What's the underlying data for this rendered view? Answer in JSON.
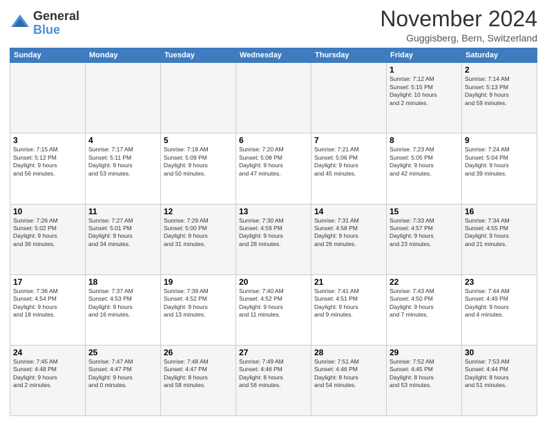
{
  "header": {
    "logo_line1": "General",
    "logo_line2": "Blue",
    "month_title": "November 2024",
    "location": "Guggisberg, Bern, Switzerland"
  },
  "days_of_week": [
    "Sunday",
    "Monday",
    "Tuesday",
    "Wednesday",
    "Thursday",
    "Friday",
    "Saturday"
  ],
  "weeks": [
    [
      {
        "day": "",
        "info": ""
      },
      {
        "day": "",
        "info": ""
      },
      {
        "day": "",
        "info": ""
      },
      {
        "day": "",
        "info": ""
      },
      {
        "day": "",
        "info": ""
      },
      {
        "day": "1",
        "info": "Sunrise: 7:12 AM\nSunset: 5:15 PM\nDaylight: 10 hours\nand 2 minutes."
      },
      {
        "day": "2",
        "info": "Sunrise: 7:14 AM\nSunset: 5:13 PM\nDaylight: 9 hours\nand 59 minutes."
      }
    ],
    [
      {
        "day": "3",
        "info": "Sunrise: 7:15 AM\nSunset: 5:12 PM\nDaylight: 9 hours\nand 56 minutes."
      },
      {
        "day": "4",
        "info": "Sunrise: 7:17 AM\nSunset: 5:11 PM\nDaylight: 9 hours\nand 53 minutes."
      },
      {
        "day": "5",
        "info": "Sunrise: 7:18 AM\nSunset: 5:09 PM\nDaylight: 9 hours\nand 50 minutes."
      },
      {
        "day": "6",
        "info": "Sunrise: 7:20 AM\nSunset: 5:08 PM\nDaylight: 9 hours\nand 47 minutes."
      },
      {
        "day": "7",
        "info": "Sunrise: 7:21 AM\nSunset: 5:06 PM\nDaylight: 9 hours\nand 45 minutes."
      },
      {
        "day": "8",
        "info": "Sunrise: 7:23 AM\nSunset: 5:05 PM\nDaylight: 9 hours\nand 42 minutes."
      },
      {
        "day": "9",
        "info": "Sunrise: 7:24 AM\nSunset: 5:04 PM\nDaylight: 9 hours\nand 39 minutes."
      }
    ],
    [
      {
        "day": "10",
        "info": "Sunrise: 7:26 AM\nSunset: 5:02 PM\nDaylight: 9 hours\nand 36 minutes."
      },
      {
        "day": "11",
        "info": "Sunrise: 7:27 AM\nSunset: 5:01 PM\nDaylight: 9 hours\nand 34 minutes."
      },
      {
        "day": "12",
        "info": "Sunrise: 7:29 AM\nSunset: 5:00 PM\nDaylight: 9 hours\nand 31 minutes."
      },
      {
        "day": "13",
        "info": "Sunrise: 7:30 AM\nSunset: 4:59 PM\nDaylight: 9 hours\nand 28 minutes."
      },
      {
        "day": "14",
        "info": "Sunrise: 7:31 AM\nSunset: 4:58 PM\nDaylight: 9 hours\nand 26 minutes."
      },
      {
        "day": "15",
        "info": "Sunrise: 7:33 AM\nSunset: 4:57 PM\nDaylight: 9 hours\nand 23 minutes."
      },
      {
        "day": "16",
        "info": "Sunrise: 7:34 AM\nSunset: 4:55 PM\nDaylight: 9 hours\nand 21 minutes."
      }
    ],
    [
      {
        "day": "17",
        "info": "Sunrise: 7:36 AM\nSunset: 4:54 PM\nDaylight: 9 hours\nand 18 minutes."
      },
      {
        "day": "18",
        "info": "Sunrise: 7:37 AM\nSunset: 4:53 PM\nDaylight: 9 hours\nand 16 minutes."
      },
      {
        "day": "19",
        "info": "Sunrise: 7:39 AM\nSunset: 4:52 PM\nDaylight: 9 hours\nand 13 minutes."
      },
      {
        "day": "20",
        "info": "Sunrise: 7:40 AM\nSunset: 4:52 PM\nDaylight: 9 hours\nand 11 minutes."
      },
      {
        "day": "21",
        "info": "Sunrise: 7:41 AM\nSunset: 4:51 PM\nDaylight: 9 hours\nand 9 minutes."
      },
      {
        "day": "22",
        "info": "Sunrise: 7:43 AM\nSunset: 4:50 PM\nDaylight: 9 hours\nand 7 minutes."
      },
      {
        "day": "23",
        "info": "Sunrise: 7:44 AM\nSunset: 4:49 PM\nDaylight: 9 hours\nand 4 minutes."
      }
    ],
    [
      {
        "day": "24",
        "info": "Sunrise: 7:45 AM\nSunset: 4:48 PM\nDaylight: 9 hours\nand 2 minutes."
      },
      {
        "day": "25",
        "info": "Sunrise: 7:47 AM\nSunset: 4:47 PM\nDaylight: 9 hours\nand 0 minutes."
      },
      {
        "day": "26",
        "info": "Sunrise: 7:48 AM\nSunset: 4:47 PM\nDaylight: 8 hours\nand 58 minutes."
      },
      {
        "day": "27",
        "info": "Sunrise: 7:49 AM\nSunset: 4:46 PM\nDaylight: 8 hours\nand 56 minutes."
      },
      {
        "day": "28",
        "info": "Sunrise: 7:51 AM\nSunset: 4:46 PM\nDaylight: 8 hours\nand 54 minutes."
      },
      {
        "day": "29",
        "info": "Sunrise: 7:52 AM\nSunset: 4:45 PM\nDaylight: 8 hours\nand 53 minutes."
      },
      {
        "day": "30",
        "info": "Sunrise: 7:53 AM\nSunset: 4:44 PM\nDaylight: 8 hours\nand 51 minutes."
      }
    ]
  ]
}
